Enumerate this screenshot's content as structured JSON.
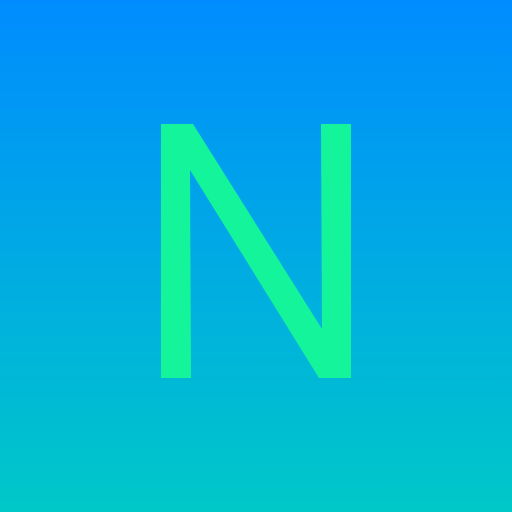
{
  "tile": {
    "letter": "N",
    "colors": {
      "gradient_top": "#008cff",
      "gradient_bottom": "#00c8c8",
      "letter": "#14f59b"
    }
  }
}
